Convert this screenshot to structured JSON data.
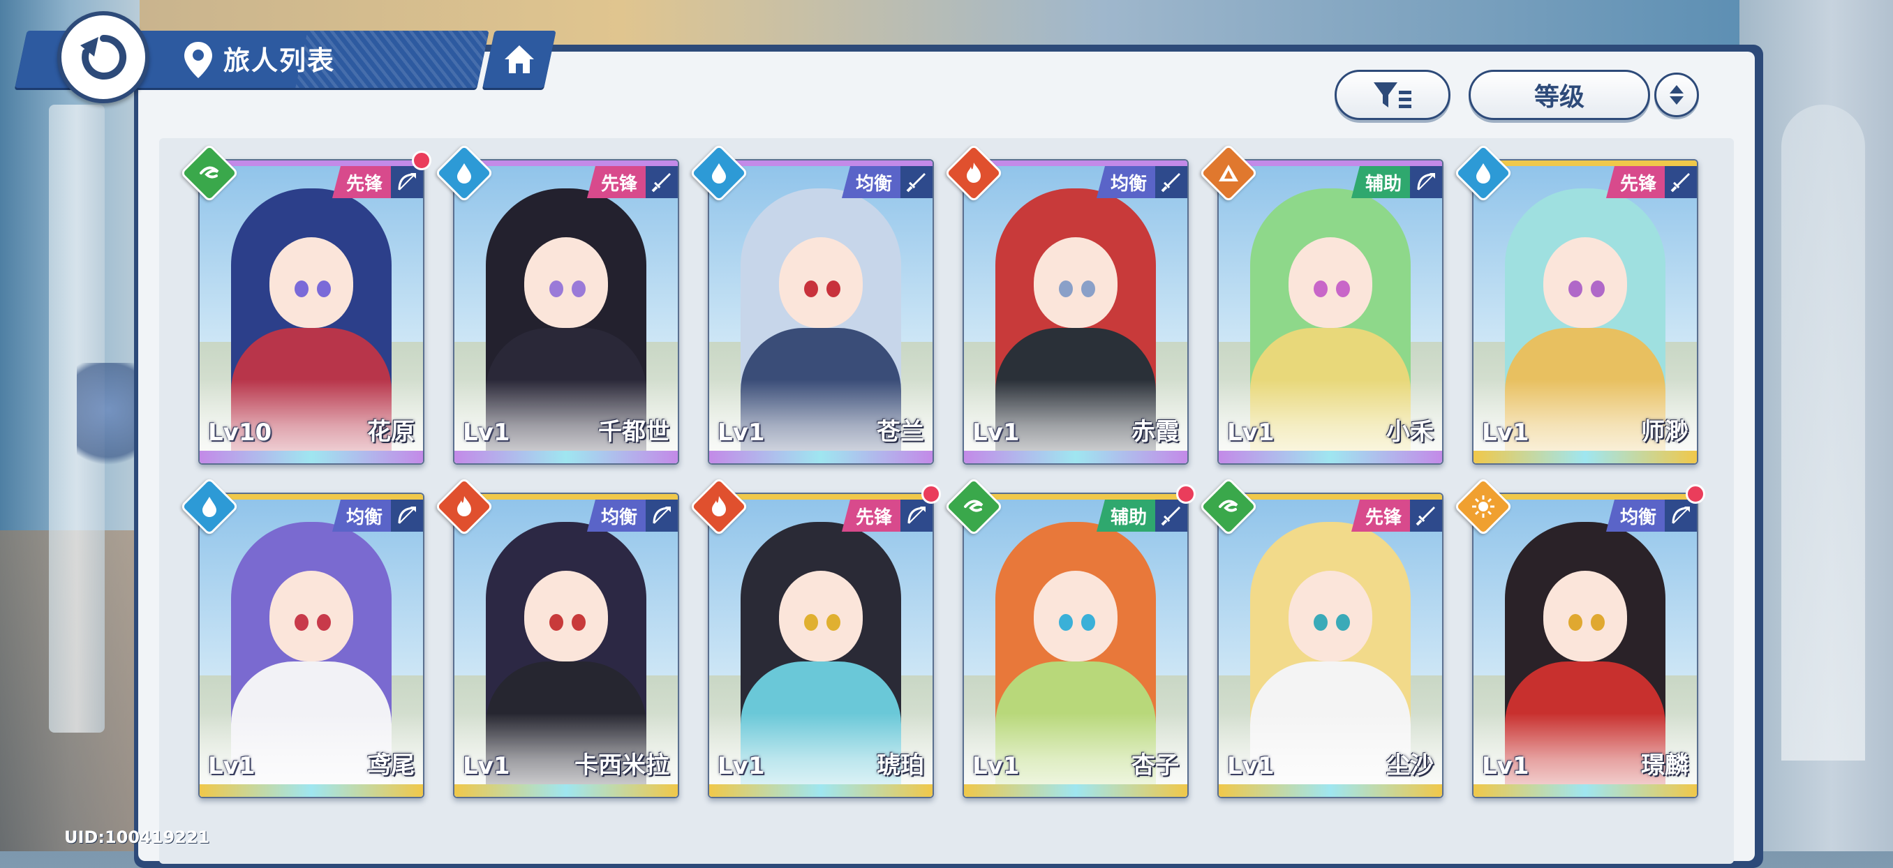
{
  "header": {
    "title": "旅人列表"
  },
  "controls": {
    "sort_label": "等级"
  },
  "uid": "UID:100419221",
  "colors": {
    "vanguard": "#d84a8c",
    "balanced": "#5a64c8",
    "support": "#2fa86e",
    "element_wind": "#3aa84b",
    "element_water": "#2d9ad6",
    "element_fire": "#e0502e",
    "element_earth": "#e0782e",
    "element_light": "#f0a030",
    "frame_purple": "#c38ae8",
    "frame_gold": "#f0c84a"
  },
  "cards": [
    {
      "name": "花原",
      "level": "Lv10",
      "role": "先锋",
      "role_color": "#d84a8c",
      "weapon": "bow-icon",
      "element": "wind-icon",
      "element_color": "#3aa84b",
      "frame": "#c38ae8",
      "hair": "#2c3f8a",
      "outfit": "#b8354a",
      "eye": "#7a6ad8",
      "new": true
    },
    {
      "name": "千都世",
      "level": "Lv1",
      "role": "先锋",
      "role_color": "#d84a8c",
      "weapon": "sword-icon",
      "element": "water-icon",
      "element_color": "#2d9ad6",
      "frame": "#c38ae8",
      "hair": "#23212e",
      "outfit": "#2a2838",
      "eye": "#9a7ad8",
      "new": false
    },
    {
      "name": "苍兰",
      "level": "Lv1",
      "role": "均衡",
      "role_color": "#5a64c8",
      "weapon": "sword-icon",
      "element": "water-icon",
      "element_color": "#2d9ad6",
      "frame": "#c38ae8",
      "hair": "#c7d6ea",
      "outfit": "#3a4d78",
      "eye": "#c8323c",
      "new": false
    },
    {
      "name": "赤霞",
      "level": "Lv1",
      "role": "均衡",
      "role_color": "#5a64c8",
      "weapon": "sword-icon",
      "element": "fire-icon",
      "element_color": "#e0502e",
      "frame": "#c38ae8",
      "hair": "#c83a3a",
      "outfit": "#2a3038",
      "eye": "#8aa0c8",
      "new": false
    },
    {
      "name": "小禾",
      "level": "Lv1",
      "role": "辅助",
      "role_color": "#2fa86e",
      "weapon": "bow-icon",
      "element": "earth-icon",
      "element_color": "#e0782e",
      "frame": "#c38ae8",
      "hair": "#8ed88a",
      "outfit": "#e8d87a",
      "eye": "#c866c8",
      "new": false
    },
    {
      "name": "师渺",
      "level": "Lv1",
      "role": "先锋",
      "role_color": "#d84a8c",
      "weapon": "sword-icon",
      "element": "water-icon",
      "element_color": "#2d9ad6",
      "frame": "#f0c84a",
      "hair": "#9fe0e0",
      "outfit": "#e8c060",
      "eye": "#b068c8",
      "new": false
    },
    {
      "name": "鸢尾",
      "level": "Lv1",
      "role": "均衡",
      "role_color": "#5a64c8",
      "weapon": "bow-icon",
      "element": "water-icon",
      "element_color": "#2d9ad6",
      "frame": "#f0c84a",
      "hair": "#7a6ad0",
      "outfit": "#f2f2f6",
      "eye": "#c83a4a",
      "new": false
    },
    {
      "name": "卡西米拉",
      "level": "Lv1",
      "role": "均衡",
      "role_color": "#5a64c8",
      "weapon": "bow-icon",
      "element": "fire-icon",
      "element_color": "#e0502e",
      "frame": "#f0c84a",
      "hair": "#2c2844",
      "outfit": "#262630",
      "eye": "#c83a3a",
      "new": false
    },
    {
      "name": "琥珀",
      "level": "Lv1",
      "role": "先锋",
      "role_color": "#d84a8c",
      "weapon": "bow-icon",
      "element": "fire-icon",
      "element_color": "#e0502e",
      "frame": "#f0c84a",
      "hair": "#2a2a36",
      "outfit": "#6ac8d8",
      "eye": "#e0b030",
      "new": true
    },
    {
      "name": "杏子",
      "level": "Lv1",
      "role": "辅助",
      "role_color": "#2fa86e",
      "weapon": "sword-icon",
      "element": "wind-icon",
      "element_color": "#3aa84b",
      "frame": "#f0c84a",
      "hair": "#e8783a",
      "outfit": "#b8d87a",
      "eye": "#3ab0d8",
      "new": true
    },
    {
      "name": "尘沙",
      "level": "Lv1",
      "role": "先锋",
      "role_color": "#d84a8c",
      "weapon": "sword-icon",
      "element": "wind-icon",
      "element_color": "#3aa84b",
      "frame": "#f0c84a",
      "hair": "#f2da8a",
      "outfit": "#f4f4f4",
      "eye": "#3aaab8",
      "new": false
    },
    {
      "name": "璟麟",
      "level": "Lv1",
      "role": "均衡",
      "role_color": "#5a64c8",
      "weapon": "bow-icon",
      "element": "light-icon",
      "element_color": "#f0a030",
      "frame": "#f0c84a",
      "hair": "#2a2228",
      "outfit": "#c8302e",
      "eye": "#e0a830",
      "new": true
    }
  ]
}
